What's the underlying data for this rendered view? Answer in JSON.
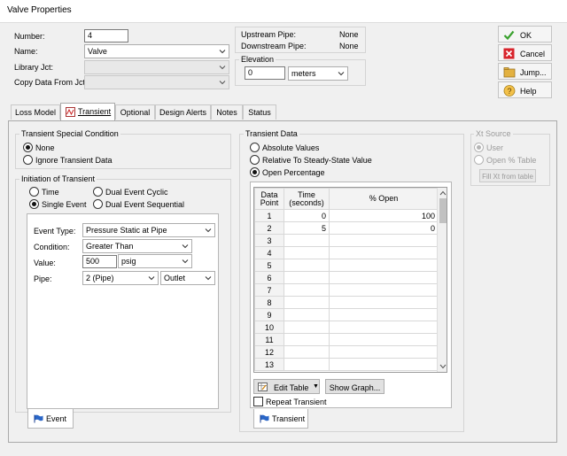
{
  "window": {
    "title": "Valve Properties"
  },
  "header": {
    "number_label": "Number:",
    "number_value": "4",
    "name_label": "Name:",
    "name_value": "Valve",
    "library_label": "Library Jct:",
    "library_value": "",
    "copy_label": "Copy Data From Jct...",
    "copy_value": ""
  },
  "pipes": {
    "upstream_label": "Upstream Pipe:",
    "upstream_value": "None",
    "downstream_label": "Downstream Pipe:",
    "downstream_value": "None"
  },
  "elevation": {
    "legend": "Elevation",
    "value": "0",
    "unit": "meters"
  },
  "buttons": {
    "ok": "OK",
    "cancel": "Cancel",
    "jump": "Jump...",
    "help": "Help"
  },
  "tabs": [
    {
      "label": "Loss Model"
    },
    {
      "label": "Transient"
    },
    {
      "label": "Optional"
    },
    {
      "label": "Design Alerts"
    },
    {
      "label": "Notes"
    },
    {
      "label": "Status"
    }
  ],
  "special": {
    "legend": "Transient Special Condition",
    "none": "None",
    "ignore": "Ignore Transient Data"
  },
  "initiation": {
    "legend": "Initiation of Transient",
    "time": "Time",
    "dual_cyclic": "Dual Event Cyclic",
    "single": "Single Event",
    "dual_sequential": "Dual Event Sequential"
  },
  "event": {
    "type_label": "Event Type:",
    "type_value": "Pressure Static at Pipe",
    "condition_label": "Condition:",
    "condition_value": "Greater Than",
    "value_label": "Value:",
    "value_value": "500",
    "value_unit": "psig",
    "pipe_label": "Pipe:",
    "pipe_value": "2 (Pipe)",
    "pipe_end": "Outlet",
    "tab_label": "Event"
  },
  "transient_data": {
    "legend": "Transient Data",
    "absolute": "Absolute Values",
    "relative": "Relative To Steady-State Value",
    "percentage": "Open Percentage",
    "col_point": "Data Point",
    "col_time": "Time (seconds)",
    "col_open": "% Open",
    "rows": [
      {
        "n": "1",
        "time": "0",
        "open": "100"
      },
      {
        "n": "2",
        "time": "5",
        "open": "0"
      },
      {
        "n": "3",
        "time": "",
        "open": ""
      },
      {
        "n": "4",
        "time": "",
        "open": ""
      },
      {
        "n": "5",
        "time": "",
        "open": ""
      },
      {
        "n": "6",
        "time": "",
        "open": ""
      },
      {
        "n": "7",
        "time": "",
        "open": ""
      },
      {
        "n": "8",
        "time": "",
        "open": ""
      },
      {
        "n": "9",
        "time": "",
        "open": ""
      },
      {
        "n": "10",
        "time": "",
        "open": ""
      },
      {
        "n": "11",
        "time": "",
        "open": ""
      },
      {
        "n": "12",
        "time": "",
        "open": ""
      },
      {
        "n": "13",
        "time": "",
        "open": ""
      }
    ],
    "edit_table": "Edit Table",
    "show_graph": "Show Graph...",
    "repeat": "Repeat Transient",
    "tab_label": "Transient"
  },
  "xt_source": {
    "legend": "Xt Source",
    "user": "User",
    "open_table": "Open % Table",
    "fill_button": "Fill Xt from table"
  }
}
